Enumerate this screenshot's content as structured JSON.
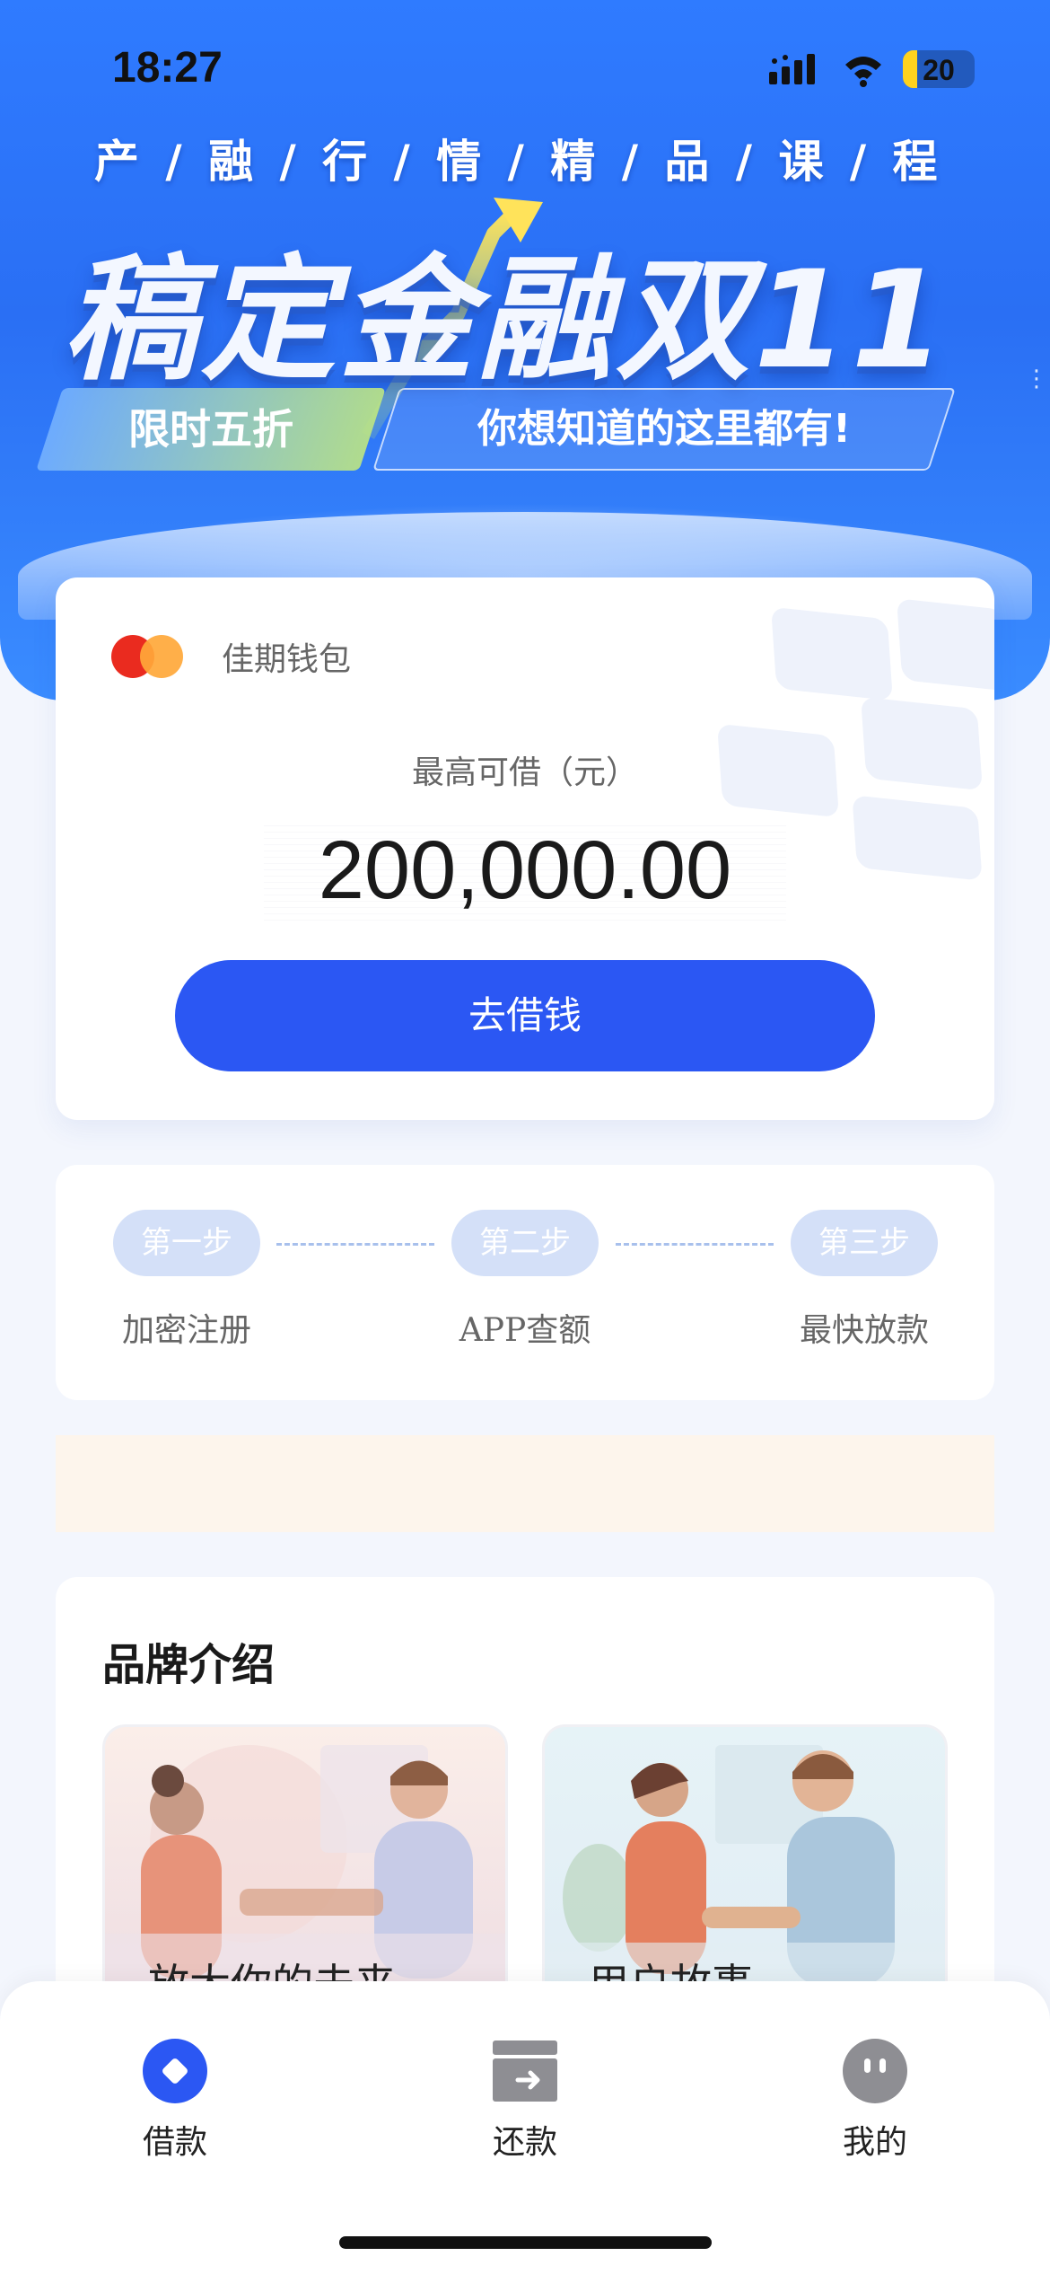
{
  "status_bar": {
    "time": "18:27",
    "battery": "20",
    "battery_level": 0.2
  },
  "banner": {
    "subtitle": "产 / 融 / 行 / 情 / 精 / 品 / 课 / 程",
    "title": "稿定金融双11",
    "promo": "限时五折",
    "tagline": "你想知道的这里都有!"
  },
  "loan_card": {
    "wallet_name": "佳期钱包",
    "limit_label": "最高可借（元）",
    "limit_amount": "200,000.00",
    "borrow_button": "去借钱"
  },
  "steps": [
    {
      "pill": "第一步",
      "label": "加密注册"
    },
    {
      "pill": "第二步",
      "label": "APP查额"
    },
    {
      "pill": "第三步",
      "label": "最快放款"
    }
  ],
  "brand": {
    "title": "品牌介绍",
    "tiles": [
      {
        "label": "放大你的未来"
      },
      {
        "label": "用户故事"
      }
    ]
  },
  "tab_bar": {
    "tabs": [
      {
        "label": "借款",
        "icon": "borrow-icon",
        "active": true
      },
      {
        "label": "还款",
        "icon": "repay-icon",
        "active": false
      },
      {
        "label": "我的",
        "icon": "profile-icon",
        "active": false
      }
    ]
  },
  "colors": {
    "primary": "#2b57f3",
    "banner_blue": "#2f7bff",
    "step_pill": "#d4e0f8",
    "notice_bg": "#fdf5ec",
    "inactive_icon": "#8e8e93"
  }
}
